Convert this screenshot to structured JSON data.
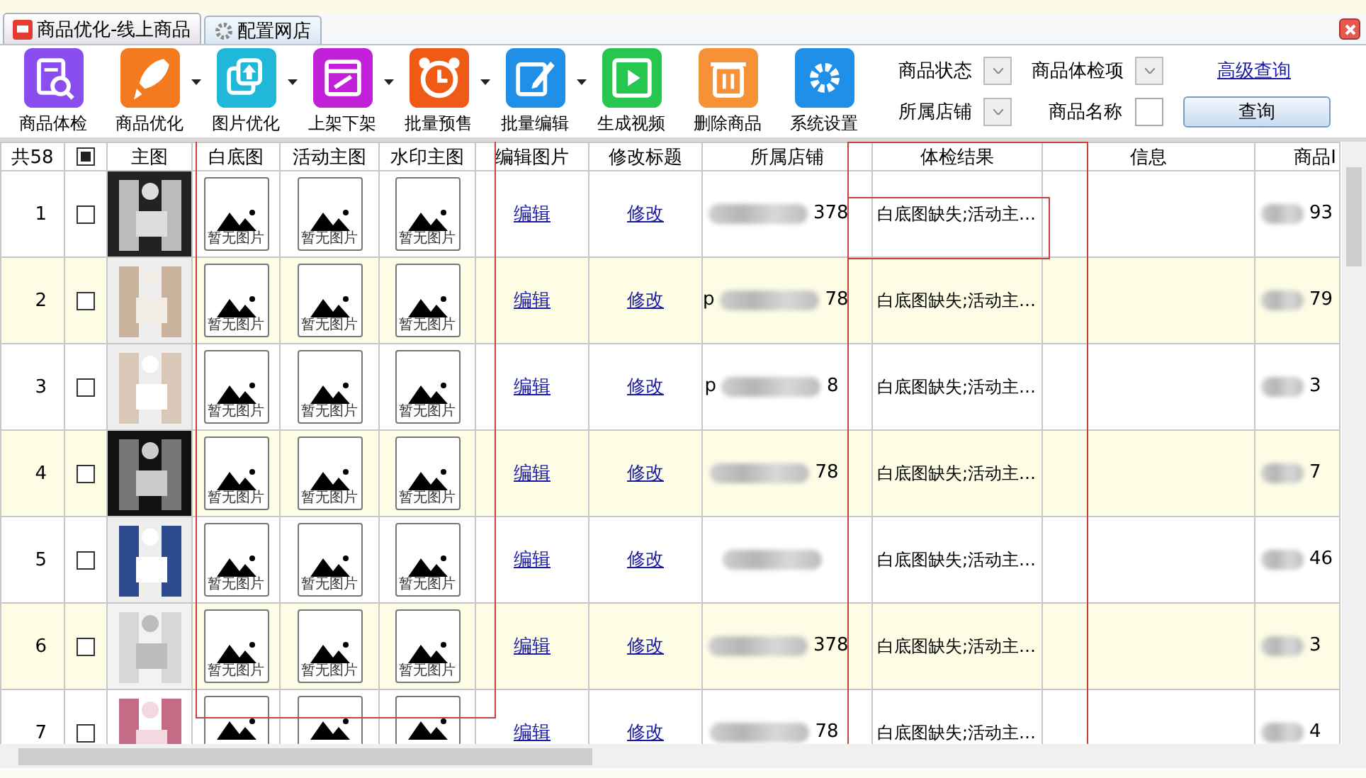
{
  "tabs": [
    {
      "label": "商品优化-线上商品",
      "selected": true,
      "kind": "logo"
    },
    {
      "label": "配置网店",
      "selected": false,
      "kind": "gear"
    }
  ],
  "toolbar": [
    {
      "label": "商品体检",
      "kind": "inspect",
      "color": "#8a4df0",
      "dropdown": false
    },
    {
      "label": "商品优化",
      "kind": "rocket",
      "color": "#f47a1f",
      "dropdown": true
    },
    {
      "label": "图片优化",
      "kind": "upload",
      "color": "#1fb8d8",
      "dropdown": true
    },
    {
      "label": "上架下架",
      "kind": "shelf",
      "color": "#c21fd8",
      "dropdown": true
    },
    {
      "label": "批量预售",
      "kind": "alarm",
      "color": "#ef5a17",
      "dropdown": true
    },
    {
      "label": "批量编辑",
      "kind": "edit",
      "color": "#1f8fe8",
      "dropdown": true
    },
    {
      "label": "生成视频",
      "kind": "video",
      "color": "#27c74f",
      "dropdown": false
    },
    {
      "label": "删除商品",
      "kind": "trash",
      "color": "#f79138",
      "dropdown": false
    },
    {
      "label": "系统设置",
      "kind": "gear",
      "color": "#1f8fe8",
      "dropdown": false
    }
  ],
  "filters": {
    "status_label": "商品状态",
    "check_label": "商品体检项",
    "advanced_link": "高级查询",
    "store_label": "所属店铺",
    "name_label": "商品名称",
    "query_button": "查询"
  },
  "table": {
    "count": "共58",
    "header_checked": true,
    "columns": [
      "主图",
      "白底图",
      "活动主图",
      "水印主图",
      "编辑图片",
      "修改标题",
      "所属店铺",
      "体检结果",
      "信息",
      "商品I"
    ],
    "rows": [
      {
        "index": "1",
        "checked": false,
        "images": [
          "暂无图片",
          "暂无图片",
          "暂无图片"
        ],
        "edit": "编辑",
        "modify": "修改",
        "store_prefix": "",
        "store_suffix": "378",
        "result": "白底图缺失;活动主…",
        "id_suffix": "93"
      },
      {
        "index": "2",
        "checked": false,
        "images": [
          "暂无图片",
          "暂无图片",
          "暂无图片"
        ],
        "edit": "编辑",
        "modify": "修改",
        "store_prefix": "p",
        "store_suffix": "78",
        "result": "白底图缺失;活动主…",
        "id_suffix": "79"
      },
      {
        "index": "3",
        "checked": false,
        "images": [
          "暂无图片",
          "暂无图片",
          "暂无图片"
        ],
        "edit": "编辑",
        "modify": "修改",
        "store_prefix": "p",
        "store_suffix": "8",
        "result": "白底图缺失;活动主…",
        "id_suffix": "3"
      },
      {
        "index": "4",
        "checked": false,
        "images": [
          "暂无图片",
          "暂无图片",
          "暂无图片"
        ],
        "edit": "编辑",
        "modify": "修改",
        "store_prefix": "",
        "store_suffix": "78",
        "result": "白底图缺失;活动主…",
        "id_suffix": "7"
      },
      {
        "index": "5",
        "checked": false,
        "images": [
          "暂无图片",
          "暂无图片",
          "暂无图片"
        ],
        "edit": "编辑",
        "modify": "修改",
        "store_prefix": "",
        "store_suffix": "",
        "result": "白底图缺失;活动主…",
        "id_suffix": "46"
      },
      {
        "index": "6",
        "checked": false,
        "images": [
          "暂无图片",
          "暂无图片",
          "暂无图片"
        ],
        "edit": "编辑",
        "modify": "修改",
        "store_prefix": "",
        "store_suffix": "378",
        "result": "白底图缺失;活动主…",
        "id_suffix": "3"
      },
      {
        "index": "7",
        "checked": false,
        "images": [
          {
            "kind": "placeholder"
          },
          {
            "kind": "placeholder"
          },
          {
            "kind": "placeholder"
          }
        ],
        "edit": "编辑",
        "modify": "修改",
        "store_prefix": "",
        "store_suffix": "78",
        "result": "白底图缺失;活动主…",
        "id_suffix": "4"
      }
    ]
  }
}
